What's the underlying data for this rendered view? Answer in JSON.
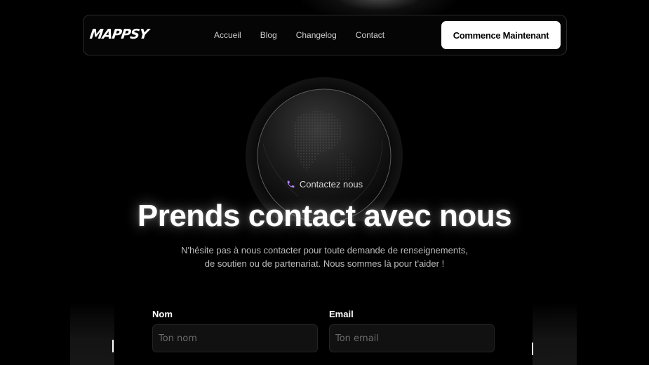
{
  "brand": {
    "logo_text": "MAPPSY"
  },
  "nav": {
    "links": [
      {
        "label": "Accueil"
      },
      {
        "label": "Blog"
      },
      {
        "label": "Changelog"
      },
      {
        "label": "Contact"
      }
    ],
    "cta_label": "Commence Maintenant"
  },
  "hero": {
    "eyebrow": "Contactez nous",
    "eyebrow_icon": "phone-icon",
    "eyebrow_icon_color": "#b07cf0",
    "title": "Prends contact avec nous",
    "subtitle": "N'hésite pas à nous contacter pour toute demande de renseignements, de soutien ou de partenariat. Nous sommes là pour t'aider !"
  },
  "form": {
    "name": {
      "label": "Nom",
      "placeholder": "Ton nom",
      "value": ""
    },
    "email": {
      "label": "Email",
      "placeholder": "Ton email",
      "value": ""
    }
  },
  "colors": {
    "background": "#000000",
    "accent": "#b07cf0",
    "cta_bg": "#ffffff"
  }
}
